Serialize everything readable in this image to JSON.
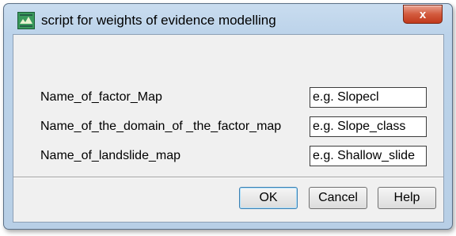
{
  "window": {
    "title": "script for weights of evidence modelling",
    "close_label": "x"
  },
  "form": {
    "rows": [
      {
        "label": "Name_of_factor_Map",
        "value": "e.g. Slopecl"
      },
      {
        "label": "Name_of_the_domain_of _the_factor_map",
        "value": "e.g. Slope_class"
      },
      {
        "label": "Name_of_landslide_map",
        "value": "e.g. Shallow_slide"
      }
    ]
  },
  "buttons": {
    "ok": "OK",
    "cancel": "Cancel",
    "help": "Help"
  },
  "icons": {
    "app": "app-map-icon",
    "close": "close-icon"
  },
  "colors": {
    "title_bar": "#bcd3ea",
    "close_button": "#c1391c",
    "client_background": "#f0f0f0"
  }
}
